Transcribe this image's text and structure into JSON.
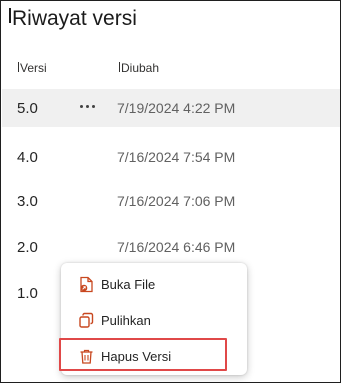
{
  "panel": {
    "title": "Riwayat versi"
  },
  "columns": {
    "version": "Versi",
    "modified": "Diubah"
  },
  "versions": [
    {
      "version": "5.0",
      "modified": "7/19/2024 4:22 PM",
      "selected": true
    },
    {
      "version": "4.0",
      "modified": "7/16/2024 7:54 PM"
    },
    {
      "version": "3.0",
      "modified": "7/16/2024 7:06 PM"
    },
    {
      "version": "2.0",
      "modified": "7/16/2024 6:46 PM"
    },
    {
      "version": "1.0",
      "modified": ""
    }
  ],
  "context_menu": {
    "items": [
      {
        "label": "Buka File",
        "icon": "open-file-icon"
      },
      {
        "label": "Pulihkan",
        "icon": "restore-icon"
      },
      {
        "label": "Hapus Versi",
        "icon": "trash-icon",
        "highlighted": true
      }
    ]
  },
  "colors": {
    "accent": "#c8471f",
    "highlight_border": "#e04848",
    "selected_row": "#f0f0f0"
  }
}
